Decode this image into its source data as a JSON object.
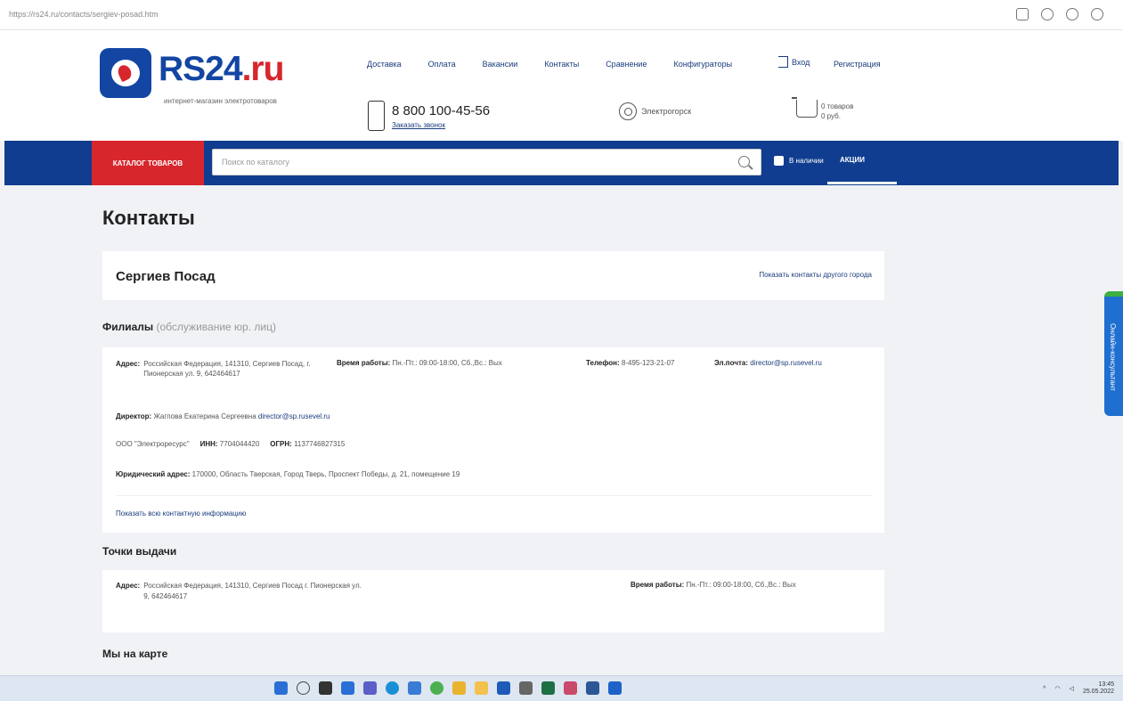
{
  "browser": {
    "url": "https://rs24.ru/contacts/sergiev-posad.htm"
  },
  "header": {
    "logo_main": "RS24",
    "logo_suffix": ".ru",
    "logo_sub": "интернет-магазин электротоваров",
    "nav": [
      "Доставка",
      "Оплата",
      "Вакансии",
      "Контакты",
      "Сравнение",
      "Конфигураторы"
    ],
    "login": "Вход",
    "register": "Регистрация",
    "phone": "8 800 100-45-56",
    "callback": "Заказать звонок",
    "city": "Электрогорск",
    "cart_line1": "0 товаров",
    "cart_line2": "0 руб."
  },
  "navbar": {
    "catalog_label": "Каталог товаров",
    "search_placeholder": "Поиск по каталогу",
    "instock_label": "В наличии",
    "actions_label": "Акции"
  },
  "page": {
    "title": "Контакты",
    "city": "Сергиев Посад",
    "other_city_link": "Показать контакты другого города",
    "branches_title": "Филиалы",
    "branches_sub": "(обслуживание юр. лиц)",
    "branch": {
      "address_label": "Адрес:",
      "address_value": "Российская Федерация, 141310, Сергиев Посад, г. Пионерская ул. 9, 642464617",
      "work_label": "Время работы:",
      "work_value": "Пн.-Пт.: 09:00-18:00, Сб.,Вс.: Вых",
      "phone_label": "Телефон:",
      "phone_value": "8-495-123-21-07",
      "email_label": "Эл.почта:",
      "email_value": "director@sp.rusevel.ru",
      "director_label": "Директор:",
      "director_value": "Жагпова Екатерина Сергеевна",
      "director_email": "director@sp.rusevel.ru",
      "company_name": "ООО \"Электроресурс\"",
      "inn_label": "ИНН:",
      "inn_value": "7704044420",
      "ogrn_label": "ОГРН:",
      "ogrn_value": "1137746827315",
      "legal_label": "Юридический адрес:",
      "legal_value": "170000, Область Тверская, Город Тверь, Проспект Победы, д. 21, помещение 19",
      "more_info": "Показать всю контактную информацию"
    },
    "pickup_title": "Точки выдачи",
    "pickup": {
      "address_label": "Адрес:",
      "address_value": "Российская Федерация, 141310, Сергиев Посад г. Пионерская ул. 9, 642464617",
      "work_label": "Время работы:",
      "work_value": "Пн.-Пт.: 09:00-18:00, Сб.,Вс.: Вых"
    },
    "map_title": "Мы на карте"
  },
  "side_tab": "Онлайн-консультант",
  "taskbar": {
    "time": "13:45",
    "date": "25.05.2022"
  },
  "colors": {
    "brand_blue": "#103d8f",
    "brand_red": "#d8262d"
  }
}
